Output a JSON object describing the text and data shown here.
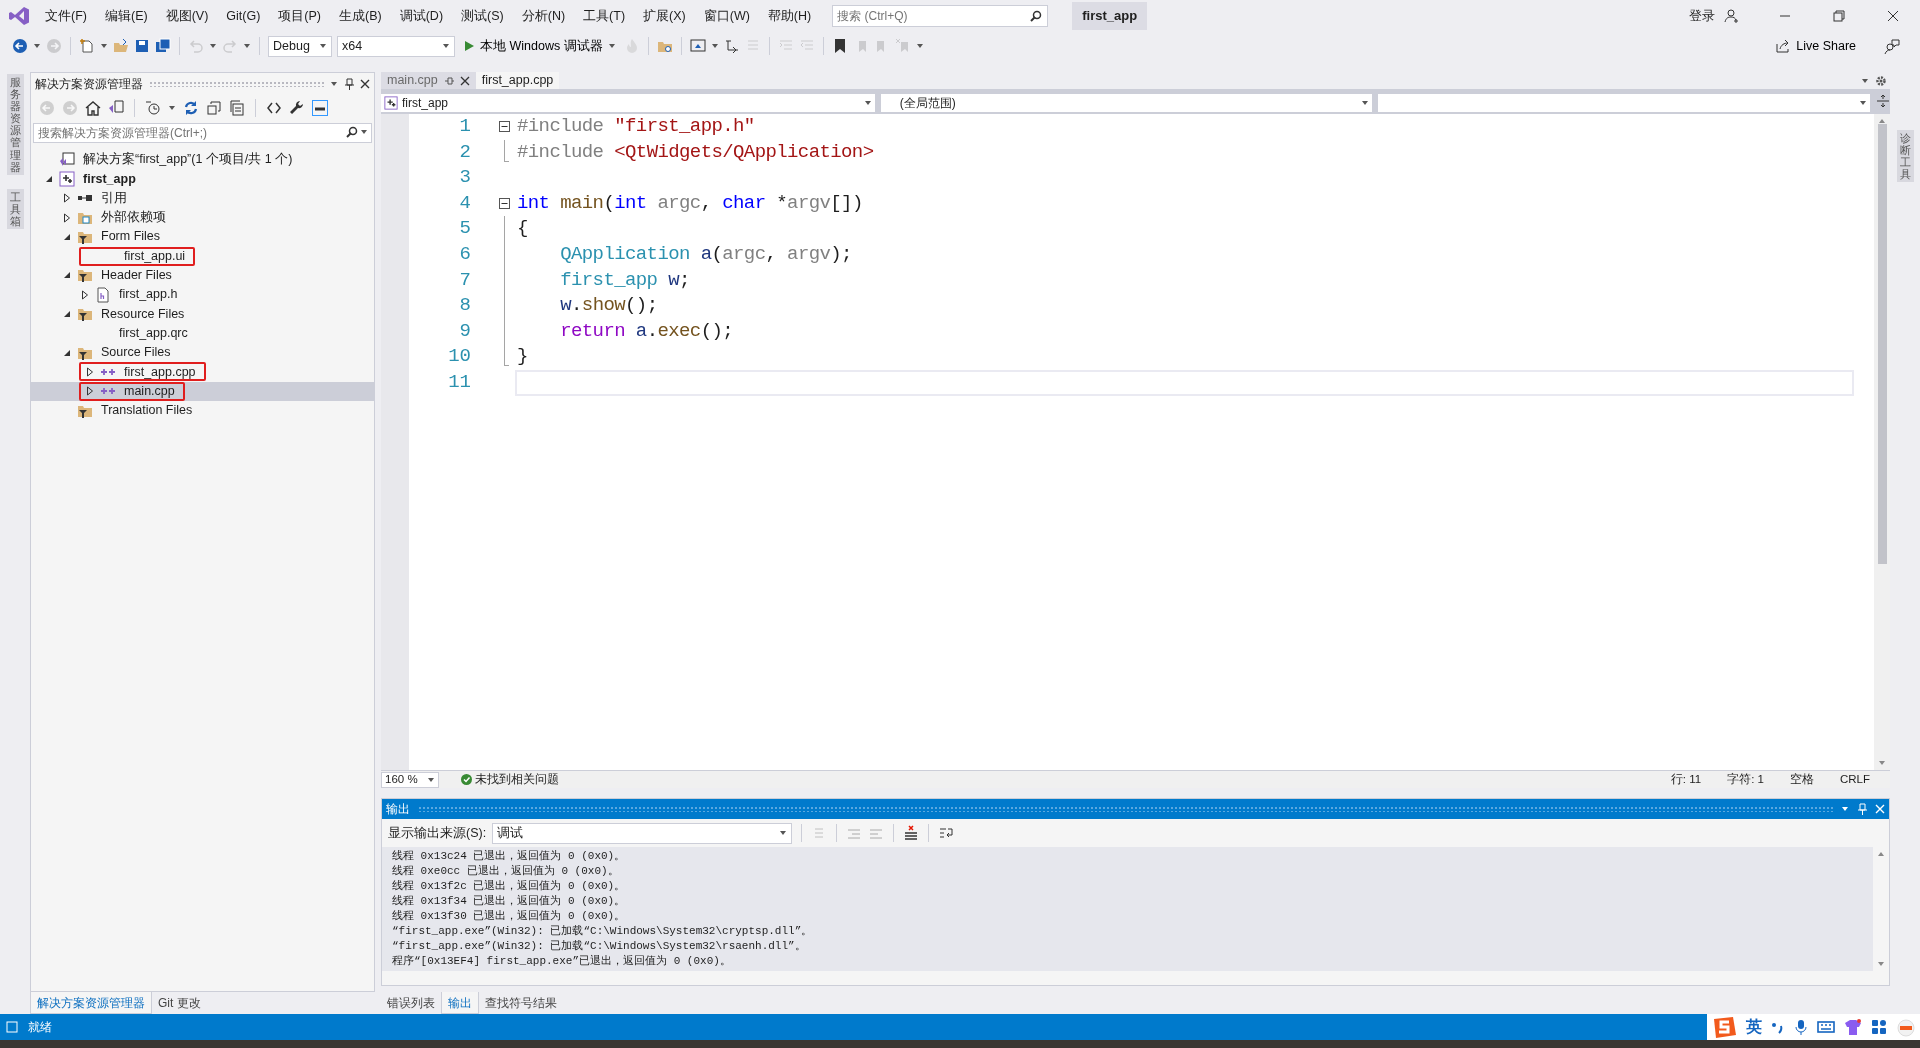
{
  "menu": [
    "文件(F)",
    "编辑(E)",
    "视图(V)",
    "Git(G)",
    "项目(P)",
    "生成(B)",
    "调试(D)",
    "测试(S)",
    "分析(N)",
    "工具(T)",
    "扩展(X)",
    "窗口(W)",
    "帮助(H)"
  ],
  "search": {
    "placeholder": "搜索 (Ctrl+Q)"
  },
  "solution_name": "first_app",
  "account": "登录",
  "toolbar": {
    "configuration": "Debug",
    "platform": "x64",
    "run_label": "本地 Windows 调试器"
  },
  "live_share": "Live Share",
  "left_strip": [
    "服务器资源管理器",
    "工具箱"
  ],
  "right_strip": [
    "诊断工具"
  ],
  "solution_explorer": {
    "title": "解决方案资源管理器",
    "search": {
      "placeholder": "搜索解决方案资源管理器(Ctrl+;)"
    },
    "tree": [
      {
        "label": "解决方案“first_app”(1 个项目/共 1 个)",
        "kind": "solution",
        "selected": false,
        "highlighted": false
      },
      {
        "label": "first_app",
        "kind": "project",
        "expanded": true,
        "selected": false,
        "highlighted": false,
        "children": [
          {
            "label": "引用",
            "kind": "references",
            "expanded": false,
            "selected": false,
            "highlighted": false
          },
          {
            "label": "外部依赖项",
            "kind": "external",
            "expanded": false,
            "selected": false,
            "highlighted": false
          },
          {
            "label": "Form Files",
            "kind": "filter",
            "expanded": true,
            "selected": false,
            "highlighted": false,
            "children": [
              {
                "label": "first_app.ui",
                "kind": "file",
                "selected": false,
                "highlighted": true
              }
            ]
          },
          {
            "label": "Header Files",
            "kind": "filter",
            "expanded": true,
            "selected": false,
            "highlighted": false,
            "children": [
              {
                "label": "first_app.h",
                "kind": "header",
                "expanded": false,
                "selected": false,
                "highlighted": false
              }
            ]
          },
          {
            "label": "Resource Files",
            "kind": "filter",
            "expanded": true,
            "selected": false,
            "highlighted": false,
            "children": [
              {
                "label": "first_app.qrc",
                "kind": "file",
                "selected": false,
                "highlighted": false
              }
            ]
          },
          {
            "label": "Source Files",
            "kind": "filter",
            "expanded": true,
            "selected": false,
            "highlighted": false,
            "children": [
              {
                "label": "first_app.cpp",
                "kind": "cpp",
                "expanded": false,
                "selected": false,
                "highlighted": true
              },
              {
                "label": "main.cpp",
                "kind": "cpp",
                "expanded": false,
                "selected": true,
                "highlighted": true
              }
            ]
          },
          {
            "label": "Translation Files",
            "kind": "filter",
            "selected": false,
            "highlighted": false
          }
        ]
      }
    ]
  },
  "left_tabs": [
    {
      "label": "解决方案资源管理器",
      "selected": true
    },
    {
      "label": "Git 更改",
      "selected": false
    }
  ],
  "editor": {
    "tabs": [
      {
        "label": "main.cpp",
        "selected": false,
        "closable": true
      },
      {
        "label": "first_app.cpp",
        "selected": true,
        "closable": false
      }
    ],
    "nav": [
      "first_app",
      "(全局范围)"
    ],
    "lines": [
      {
        "number": "1",
        "kind": "foldstart",
        "current": false,
        "tokens": [
          {
            "t": "#include",
            "kind": "pp"
          },
          {
            "t": " \"first_app.h\"",
            "kind": "str"
          }
        ]
      },
      {
        "number": "2",
        "kind": "foldend",
        "current": false,
        "tokens": [
          {
            "t": "#include",
            "kind": "pp"
          },
          {
            "t": " <QtWidgets/QApplication>",
            "kind": "str"
          }
        ]
      },
      {
        "number": "3",
        "kind": "plain",
        "current": false
      },
      {
        "number": "4",
        "kind": "foldstart",
        "current": false,
        "tokens": [
          {
            "t": "int",
            "kind": "kw"
          },
          {
            "t": " main",
            "kind": "func"
          },
          {
            "t": "(",
            "kind": "plain"
          },
          {
            "t": "int",
            "kind": "kw"
          },
          {
            "t": " argc",
            "kind": "param"
          },
          {
            "t": ", ",
            "kind": "plain"
          },
          {
            "t": "char",
            "kind": "kw"
          },
          {
            "t": " *",
            "kind": "plain"
          },
          {
            "t": "argv",
            "kind": "param"
          },
          {
            "t": "[])",
            "kind": "plain"
          }
        ]
      },
      {
        "number": "5",
        "kind": "foldinner",
        "current": false,
        "tokens": [
          {
            "t": "{",
            "kind": "plain"
          }
        ]
      },
      {
        "number": "6",
        "kind": "foldinner",
        "current": false,
        "tokens": [
          {
            "t": "    QApplication",
            "kind": "type"
          },
          {
            "t": " a",
            "kind": "var"
          },
          {
            "t": "(",
            "kind": "plain"
          },
          {
            "t": "argc",
            "kind": "param"
          },
          {
            "t": ", ",
            "kind": "plain"
          },
          {
            "t": "argv",
            "kind": "param"
          },
          {
            "t": ");",
            "kind": "plain"
          }
        ]
      },
      {
        "number": "7",
        "kind": "foldinner",
        "current": false,
        "tokens": [
          {
            "t": "    first_app",
            "kind": "type"
          },
          {
            "t": " w",
            "kind": "var"
          },
          {
            "t": ";",
            "kind": "plain"
          }
        ]
      },
      {
        "number": "8",
        "kind": "foldinner",
        "current": false,
        "tokens": [
          {
            "t": "    w",
            "kind": "var"
          },
          {
            "t": ".",
            "kind": "plain"
          },
          {
            "t": "show",
            "kind": "func"
          },
          {
            "t": "();",
            "kind": "plain"
          }
        ]
      },
      {
        "number": "9",
        "kind": "foldinner",
        "current": false,
        "tokens": [
          {
            "t": "    return",
            "kind": "ret"
          },
          {
            "t": " a",
            "kind": "var"
          },
          {
            "t": ".",
            "kind": "plain"
          },
          {
            "t": "exec",
            "kind": "func"
          },
          {
            "t": "();",
            "kind": "plain"
          }
        ]
      },
      {
        "number": "10",
        "kind": "foldend",
        "current": false,
        "tokens": [
          {
            "t": "}",
            "kind": "plain"
          }
        ]
      },
      {
        "number": "11",
        "kind": "plain",
        "current": true
      }
    ],
    "zoom": "160 %",
    "issues": "未找到相关问题",
    "position": [
      "行: 11",
      "字符: 1",
      "空格",
      "CRLF"
    ]
  },
  "output": {
    "title": "输出",
    "source_label": "显示输出来源(S):",
    "source": "调试",
    "lines": [
      "线程 0x13c24 已退出，返回值为 0 (0x0)。",
      "线程 0xe0cc 已退出，返回值为 0 (0x0)。",
      "线程 0x13f2c 已退出，返回值为 0 (0x0)。",
      "线程 0x13f34 已退出，返回值为 0 (0x0)。",
      "线程 0x13f30 已退出，返回值为 0 (0x0)。",
      "“first_app.exe”(Win32): 已加载“C:\\Windows\\System32\\cryptsp.dll”。",
      "“first_app.exe”(Win32): 已加载“C:\\Windows\\System32\\rsaenh.dll”。",
      "程序“[0x13EF4] first_app.exe”已退出，返回值为 0 (0x0)。"
    ]
  },
  "output_tabs": [
    {
      "label": "错误列表",
      "selected": false
    },
    {
      "label": "输出",
      "selected": true
    },
    {
      "label": "查找符号结果",
      "selected": false
    }
  ],
  "status": "就绪",
  "ime_mode": "英"
}
